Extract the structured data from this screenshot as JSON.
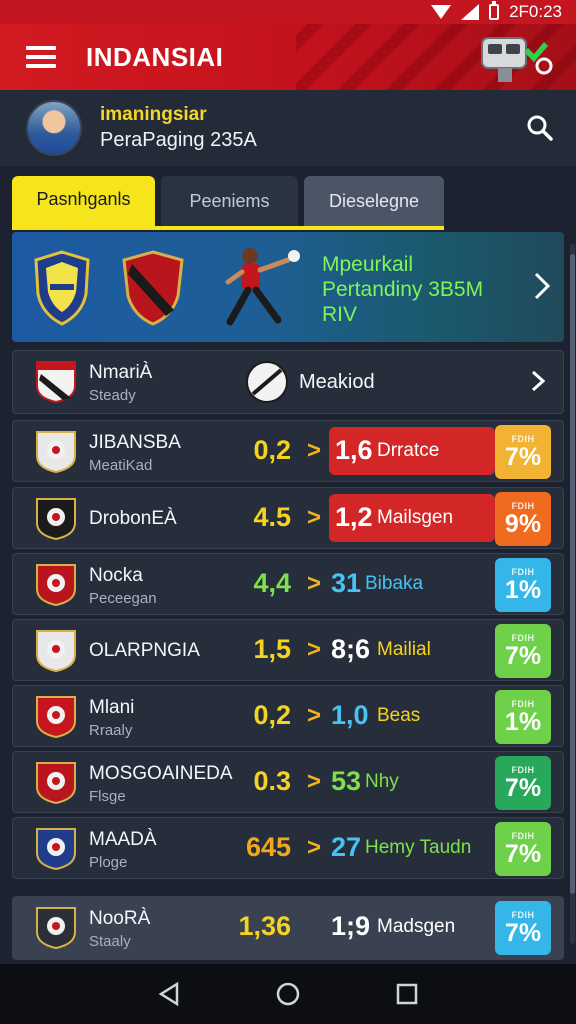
{
  "status_bar": {
    "time": "2F0:23"
  },
  "app_bar": {
    "title": "INDANSIAI"
  },
  "profile": {
    "name": "imaningsiar",
    "subtitle": "PeraPaging 235A"
  },
  "tabs": [
    {
      "label": "Pasnhganls"
    },
    {
      "label": "Peeniems"
    },
    {
      "label": "Dieselegne"
    }
  ],
  "banner": {
    "line1": "Mpeurkail",
    "line2": "Pertandiny 3B5M",
    "line3": "RIV"
  },
  "featured": {
    "team": "NmariÀ",
    "sub": "Steady",
    "center_label": "Meakiod"
  },
  "matches": [
    {
      "team": "JIBANSBA",
      "sub": "MeatiKad",
      "odds": "0,2",
      "odds_color": "#f5d320",
      "arrow": ">",
      "pick_num": "1,6",
      "pick_num_color": "#ffffff",
      "pick_label": "Drratce",
      "pick_label_color": "#ffffff",
      "pick_bg": "red",
      "badge_top": "FDIH",
      "badge_val": "7%",
      "badge_color": "#f2b233"
    },
    {
      "team": "DrobonEÀ",
      "sub": "",
      "odds": "4.5",
      "odds_color": "#f5d320",
      "arrow": ">",
      "pick_num": "1,2",
      "pick_num_color": "#ffffff",
      "pick_label": "Mailsgen",
      "pick_label_color": "#ffffff",
      "pick_bg": "red",
      "badge_top": "FDIH",
      "badge_val": "9%",
      "badge_color": "#f06a1f"
    },
    {
      "team": "Nocka",
      "sub": "Peceegan",
      "odds": "4,4",
      "odds_color": "#7ee04a",
      "arrow": ">",
      "pick_num": "31",
      "pick_num_color": "#46c3f2",
      "pick_label": "Bibaka",
      "pick_label_color": "#46c3f2",
      "pick_bg": "none",
      "badge_top": "FDIH",
      "badge_val": "1%",
      "badge_color": "#35b6e8"
    },
    {
      "team": "OLARPNGIA",
      "sub": "",
      "odds": "1,5",
      "odds_color": "#f5d320",
      "arrow": ">",
      "pick_num": "8;6",
      "pick_num_color": "#ffffff",
      "pick_label": "Mailial",
      "pick_label_color": "#f5d320",
      "pick_bg": "none",
      "badge_top": "FDIH",
      "badge_val": "7%",
      "badge_color": "#6fd04a"
    },
    {
      "team": "Mlani",
      "sub": "Rraaly",
      "odds": "0,2",
      "odds_color": "#f5d320",
      "arrow": ">",
      "pick_num": "1,0",
      "pick_num_color": "#46c3f2",
      "pick_label": "Beas",
      "pick_label_color": "#f5d320",
      "pick_bg": "none",
      "badge_top": "FDIH",
      "badge_val": "1%",
      "badge_color": "#6fd04a"
    },
    {
      "team": "MOSGOAINEDA",
      "sub": "Flsge",
      "odds": "0.3",
      "odds_color": "#f5d320",
      "arrow": ">",
      "pick_num": "53",
      "pick_num_color": "#7ee04a",
      "pick_label": "Nhy",
      "pick_label_color": "#7ee04a",
      "pick_bg": "none",
      "badge_top": "FDIH",
      "badge_val": "7%",
      "badge_color": "#27a85a"
    },
    {
      "team": "MAADÀ",
      "sub": "Ploge",
      "odds": "645",
      "odds_color": "#f2a81c",
      "arrow": ">",
      "pick_num": "27",
      "pick_num_color": "#46c3f2",
      "pick_label": "Hemy Taudn",
      "pick_label_color": "#7ee04a",
      "pick_bg": "none",
      "badge_top": "FDIH",
      "badge_val": "7%",
      "badge_color": "#6fd04a"
    },
    {
      "team": "NooRÀ",
      "sub": "Staaly",
      "odds": "1,36",
      "odds_color": "#f5d320",
      "arrow": "",
      "pick_num": "1;9",
      "pick_num_color": "#ffffff",
      "pick_label": "Madsgen",
      "pick_label_color": "#ffffff",
      "pick_bg": "none",
      "badge_top": "FDIH",
      "badge_val": "7%",
      "badge_color": "#35b6e8"
    }
  ]
}
